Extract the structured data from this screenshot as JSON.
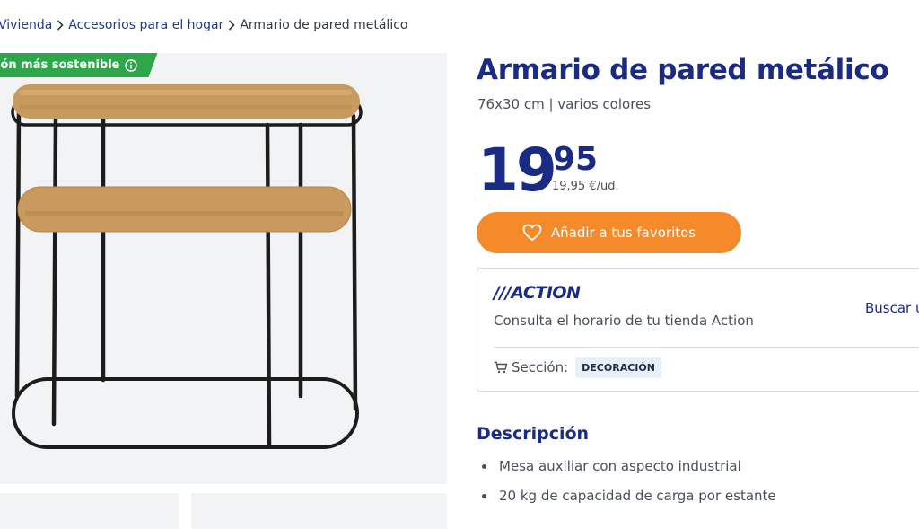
{
  "breadcrumb": {
    "items": [
      "Vivienda",
      "Accesorios para el hogar"
    ],
    "current": "Armario de pared metálico"
  },
  "gallery": {
    "badge_label": "ión más sostenible"
  },
  "product": {
    "title": "Armario de pared metálico",
    "subtitle": "76x30 cm | varios colores",
    "price_integer": "19",
    "price_decimal": "95",
    "unit_price": "19,95 €/ud.",
    "favorite_label": "Añadir a tus favoritos"
  },
  "store": {
    "logo_text": "///ACTION",
    "hint": "Consulta el horario de tu tienda Action",
    "find_label": "Buscar u",
    "section_label": "Sección:",
    "section_tag": "DECORACIÓN"
  },
  "description": {
    "heading": "Descripción",
    "items": [
      "Mesa auxiliar con aspecto industrial",
      "20 kg de capacidad de carga por estante"
    ]
  },
  "colors": {
    "brand_blue": "#1a2b85",
    "accent_orange": "#f58a2b",
    "eco_green": "#2ea64a"
  },
  "icons": [
    "chevron-right-icon",
    "info-icon",
    "heart-icon",
    "cart-icon"
  ]
}
